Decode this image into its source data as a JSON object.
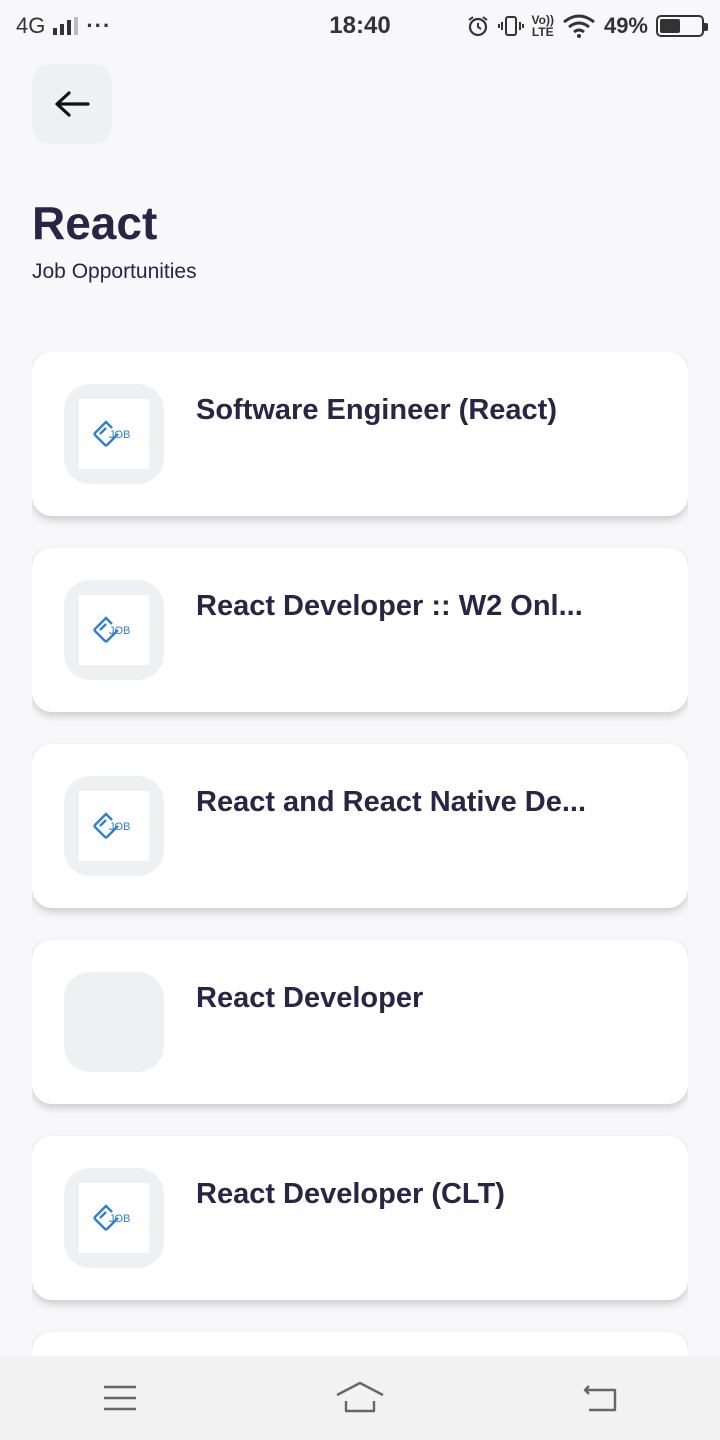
{
  "status_bar": {
    "network": "4G",
    "dots": "···",
    "time": "18:40",
    "lte_top": "Vo))",
    "lte_bottom": "LTE",
    "battery_percent": "49%",
    "battery_level": 0.49
  },
  "header": {
    "title": "React",
    "subtitle": "Job Opportunities"
  },
  "jobs": [
    {
      "title": "Software Engineer (React)",
      "logo": "job-logo",
      "logo_text": "JOB"
    },
    {
      "title": "React Developer :: W2 Onl...",
      "logo": "job-logo",
      "logo_text": "JOB"
    },
    {
      "title": "React and React Native De...",
      "logo": "job-logo",
      "logo_text": "JOB"
    },
    {
      "title": "React Developer",
      "logo": "none",
      "logo_text": ""
    },
    {
      "title": "React Developer (CLT)",
      "logo": "job-logo",
      "logo_text": "JOB"
    }
  ],
  "icons": {
    "back": "arrow-left-icon",
    "menu": "menu-icon",
    "home": "home-icon",
    "return": "return-icon"
  },
  "colors": {
    "text": "#2b2545",
    "logo_blue": "#2f7fd1",
    "background": "#f8f8fb"
  }
}
